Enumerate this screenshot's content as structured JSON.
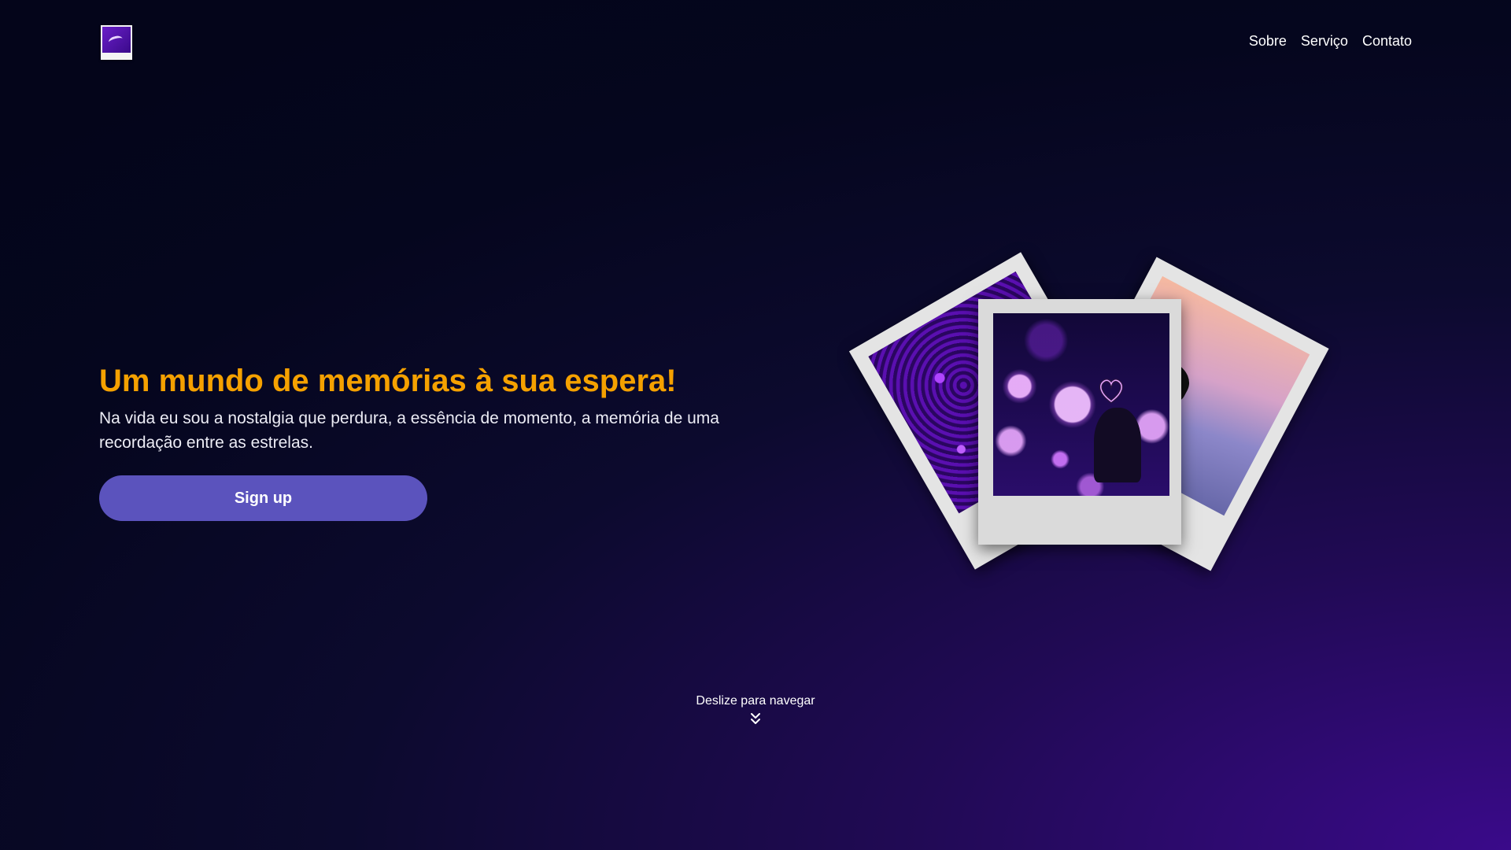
{
  "header": {
    "logo_icon": "polaroid-logo-icon",
    "nav": [
      {
        "label": "Sobre"
      },
      {
        "label": "Serviço"
      },
      {
        "label": "Contato"
      }
    ]
  },
  "hero": {
    "title": "Um mundo de memórias à sua espera!",
    "subtitle": "Na vida eu sou a nostalgia que perdura, a essência de momento, a memória de uma recordação entre as estrelas.",
    "cta_label": "Sign up"
  },
  "gallery": {
    "photos": [
      "purple-flowers-photo",
      "bokeh-heart-bell-photo",
      "umbrella-sunset-photo"
    ]
  },
  "scroll_hint": {
    "label": "Deslize para navegar",
    "icon": "double-chevron-down-icon"
  },
  "colors": {
    "title": "#f5a100",
    "button": "#5b53bd",
    "background_dark": "#04051a",
    "background_accent": "#3a0a8a"
  }
}
